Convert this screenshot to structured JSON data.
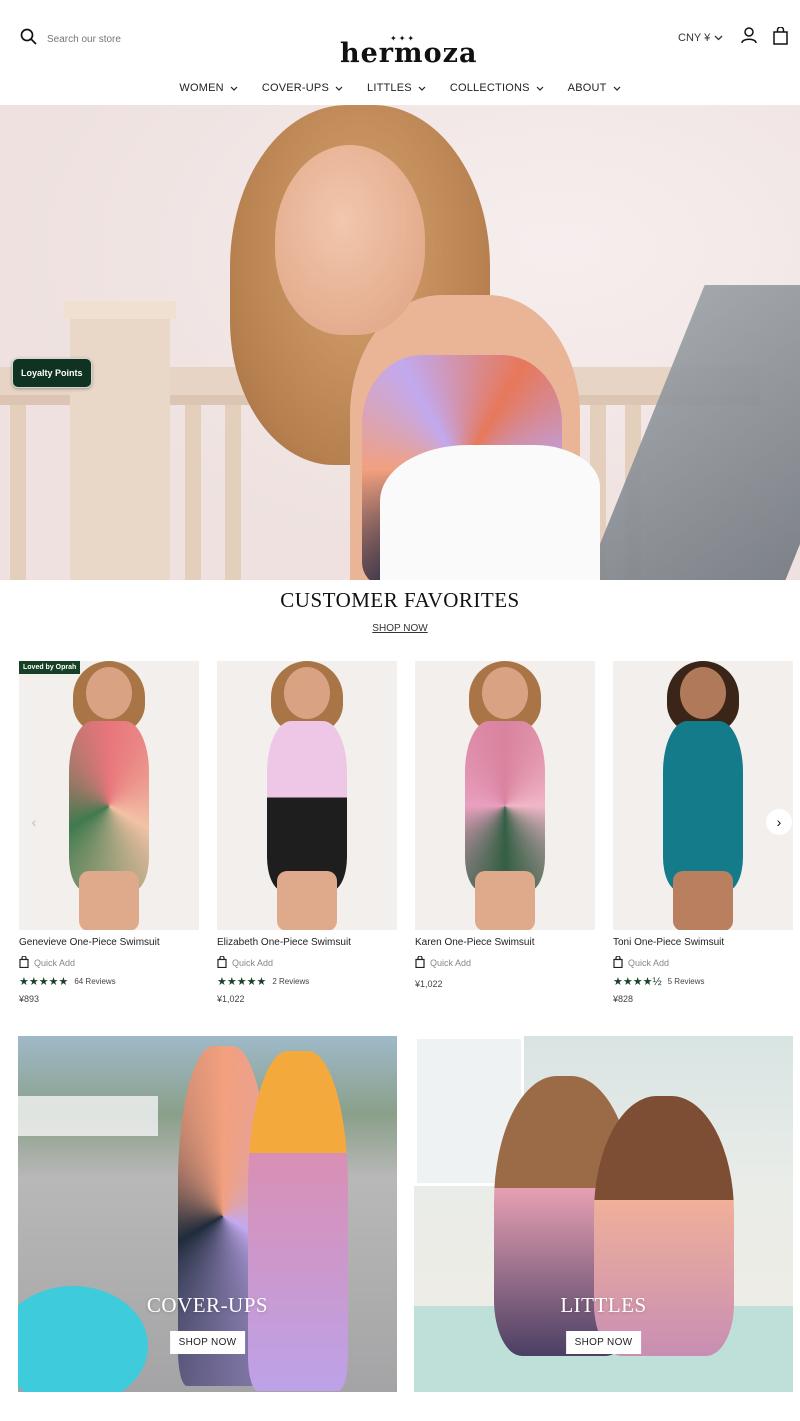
{
  "header": {
    "search_placeholder": "Search our store",
    "logo_text": "hermoza",
    "logo_stars": "✦✦✦",
    "currency": "CNY ¥"
  },
  "nav": {
    "items": [
      {
        "label": "WOMEN"
      },
      {
        "label": "COVER-UPS"
      },
      {
        "label": "LITTLES"
      },
      {
        "label": "COLLECTIONS"
      },
      {
        "label": "ABOUT"
      }
    ]
  },
  "hero": {
    "loyalty_label": "Loyalty Points"
  },
  "favorites": {
    "title": "CUSTOMER FAVORITES",
    "shop_label": "SHOP NOW",
    "quick_add_label": "Quick Add",
    "products": [
      {
        "name": "Genevieve One-Piece Swimsuit",
        "badge": "Loved by Oprah",
        "stars": "★★★★★",
        "rating": 5,
        "reviews": "64 Reviews",
        "price": "¥893",
        "suit_color": "#e8767c"
      },
      {
        "name": "Elizabeth One-Piece Swimsuit",
        "badge": "",
        "stars": "★★★★★",
        "rating": 5,
        "reviews": "2 Reviews",
        "price": "¥1,022",
        "suit_color": "#2a2a2a"
      },
      {
        "name": "Karen One-Piece Swimsuit",
        "badge": "",
        "stars": "",
        "rating": null,
        "reviews": "",
        "price": "¥1,022",
        "suit_color": "#d9839f"
      },
      {
        "name": "Toni One-Piece Swimsuit",
        "badge": "",
        "stars": "★★★★½",
        "rating": 4.5,
        "reviews": "5 Reviews",
        "price": "¥828",
        "suit_color": "#137b8a"
      }
    ]
  },
  "collections": [
    {
      "label": "COVER-UPS",
      "button": "SHOP NOW"
    },
    {
      "label": "LITTLES",
      "button": "SHOP NOW"
    }
  ],
  "colors": {
    "brand_green": "#164127",
    "star_green": "#1b4229"
  }
}
